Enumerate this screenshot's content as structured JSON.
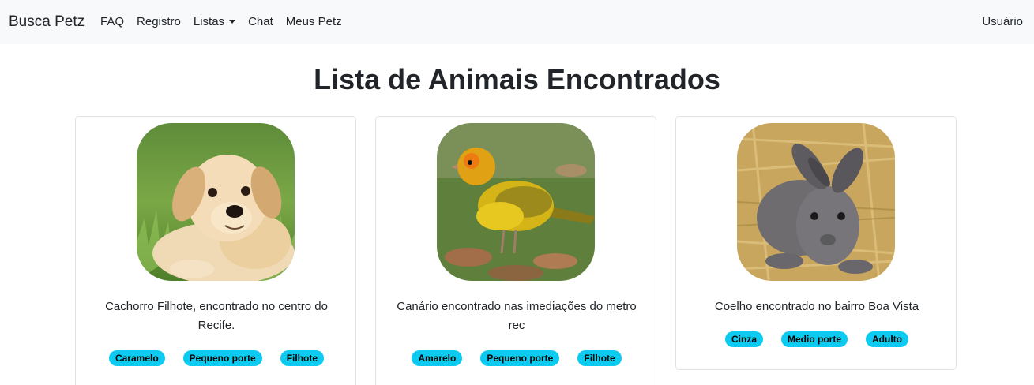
{
  "navbar": {
    "brand": "Busca Petz",
    "links": [
      "FAQ",
      "Registro",
      "Listas",
      "Chat",
      "Meus Petz"
    ],
    "user": "Usuário"
  },
  "page": {
    "title": "Lista de Animais Encontrados"
  },
  "cards": [
    {
      "image": "puppy-photo",
      "description": "Cachorro Filhote, encontrado no centro do Recife.",
      "tags": [
        "Caramelo",
        "Pequeno porte",
        "Filhote"
      ]
    },
    {
      "image": "canary-photo",
      "description": "Canário encontrado nas imediações do metro rec",
      "tags": [
        "Amarelo",
        "Pequeno porte",
        "Filhote"
      ]
    },
    {
      "image": "rabbit-photo",
      "description": "Coelho encontrado no bairro Boa Vista",
      "tags": [
        "Cinza",
        "Medio porte",
        "Adulto"
      ]
    }
  ],
  "colors": {
    "badge": "#0dcaf0",
    "navbar_bg": "#f8f9fa",
    "card_border": "#dee2e6"
  }
}
